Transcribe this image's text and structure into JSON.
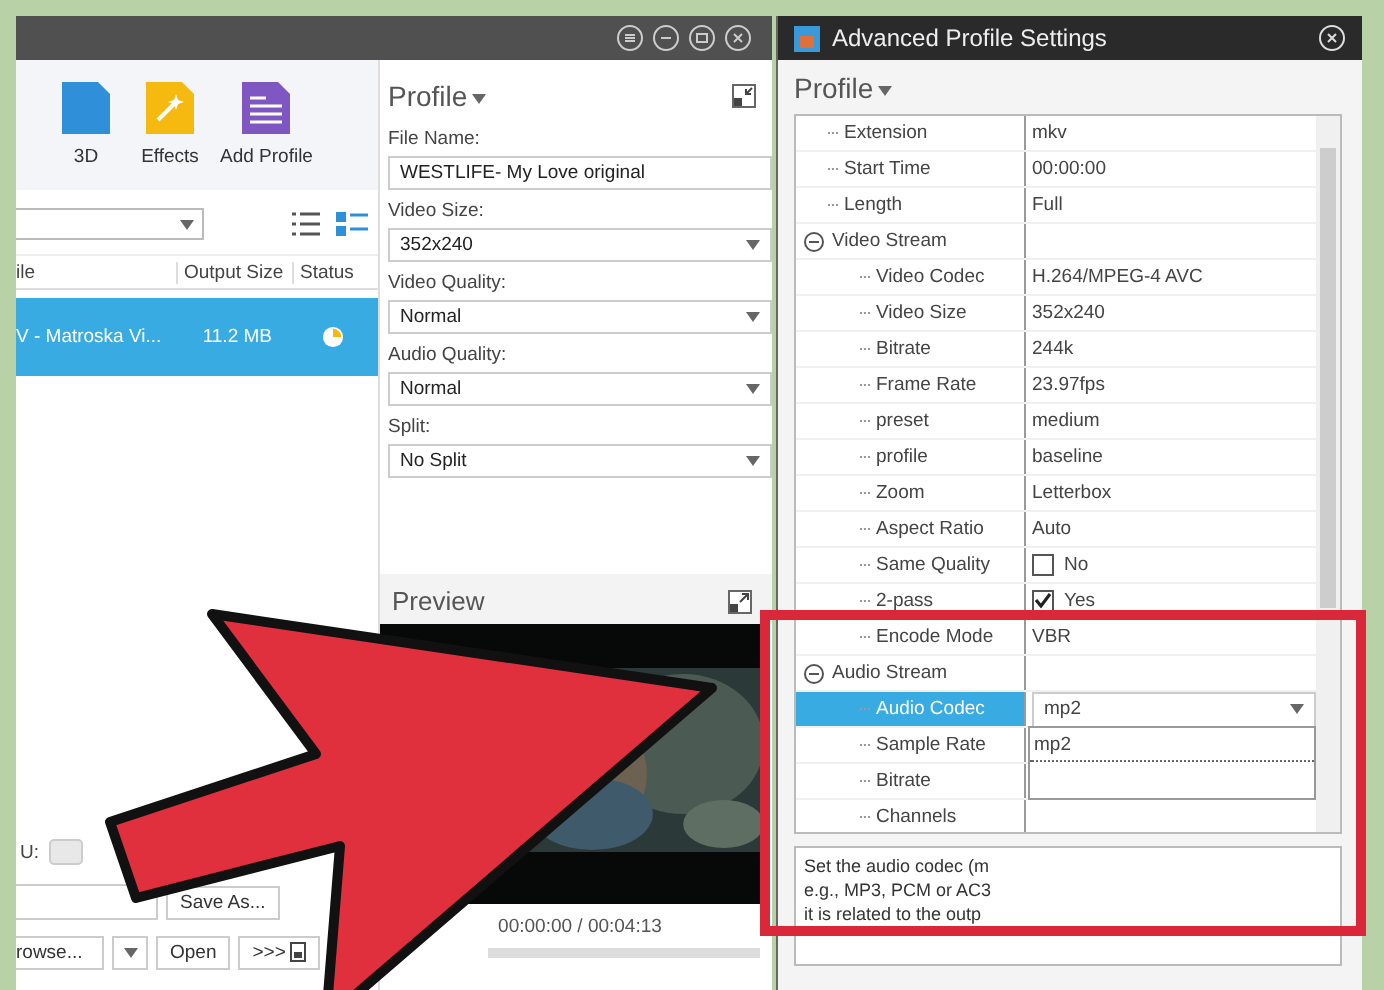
{
  "main_window": {
    "toolbar": [
      {
        "label": "3D"
      },
      {
        "label": "Effects"
      },
      {
        "label": "Add Profile"
      }
    ],
    "table": {
      "columns": [
        "ile",
        "Output Size",
        "Status"
      ],
      "rows": [
        {
          "cells": [
            "V - Matroska Vi...",
            "11.2 MB"
          ],
          "selected": true
        }
      ]
    },
    "bottom": {
      "label": "U:",
      "save_as": "Save As...",
      "browse": "rowse...",
      "open": "Open",
      "more": ">>>"
    },
    "profile": {
      "title": "Profile",
      "fields": [
        {
          "label": "File Name:",
          "value": "WESTLIFE- My Love original",
          "kind": "text"
        },
        {
          "label": "Video Size:",
          "value": "352x240",
          "kind": "select"
        },
        {
          "label": "Video Quality:",
          "value": "Normal",
          "kind": "select"
        },
        {
          "label": "Audio Quality:",
          "value": "Normal",
          "kind": "select"
        },
        {
          "label": "Split:",
          "value": "No Split",
          "kind": "select"
        }
      ]
    },
    "preview": {
      "title": "Preview",
      "time": "00:00:00 / 00:04:13"
    }
  },
  "advanced_window": {
    "title": "Advanced Profile Settings",
    "profile_label": "Profile",
    "properties": [
      {
        "name": "Extension",
        "value": "mkv",
        "selected": false
      },
      {
        "name": "Start Time",
        "value": "00:00:00",
        "selected": false
      },
      {
        "name": "Length",
        "value": "Full",
        "selected": false
      },
      {
        "name": "Video Stream",
        "kind": "group",
        "expanded": true,
        "selected": false,
        "children": [
          {
            "name": "Video Codec",
            "value": "H.264/MPEG-4 AVC",
            "selected": false
          },
          {
            "name": "Video Size",
            "value": "352x240",
            "selected": false
          },
          {
            "name": "Bitrate",
            "value": "244k",
            "selected": false
          },
          {
            "name": "Frame Rate",
            "value": "23.97fps",
            "selected": false
          },
          {
            "name": "preset",
            "value": "medium",
            "selected": false
          },
          {
            "name": "profile",
            "value": "baseline",
            "selected": false
          },
          {
            "name": "Zoom",
            "value": "Letterbox",
            "selected": false
          },
          {
            "name": "Aspect Ratio",
            "value": "Auto",
            "selected": false
          },
          {
            "name": "Same Quality",
            "kind": "checkbox",
            "checked": false,
            "value": "No",
            "selected": false
          },
          {
            "name": "2-pass",
            "kind": "checkbox",
            "checked": true,
            "value": "Yes",
            "selected": false
          },
          {
            "name": "Encode Mode",
            "value": "VBR",
            "selected": false
          }
        ]
      },
      {
        "name": "Audio Stream",
        "kind": "group",
        "expanded": true,
        "selected": false,
        "children": [
          {
            "name": "Audio Codec",
            "kind": "dropdown",
            "value": "mp2",
            "open": true,
            "options": [
              "mp2"
            ],
            "selected": true
          },
          {
            "name": "Sample Rate",
            "selected": false
          },
          {
            "name": "Bitrate",
            "selected": false
          },
          {
            "name": "Channels",
            "selected": false
          }
        ]
      }
    ],
    "description": [
      "Set the audio codec (m",
      "e.g., MP3, PCM or AC3",
      "it is related to the outp"
    ]
  }
}
